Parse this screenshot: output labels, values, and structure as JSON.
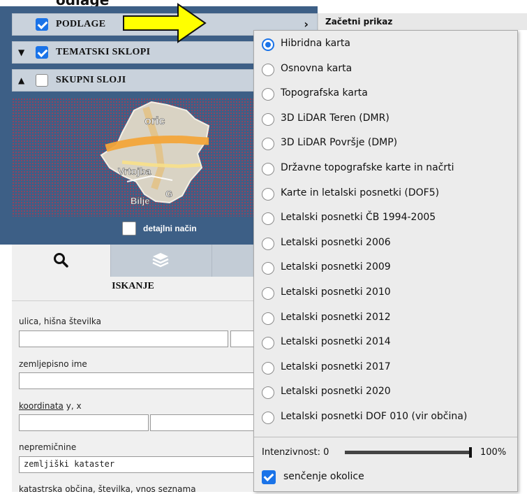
{
  "top_strip": {
    "text": "odlage"
  },
  "layers": [
    {
      "label": "PODLAGE",
      "checked": true,
      "caret": "",
      "chevron": "›"
    },
    {
      "label": "TEMATSKI SKLOPI",
      "checked": true,
      "caret": "▼",
      "chevron": ""
    },
    {
      "label": "SKUPNI SLOJI",
      "checked": false,
      "caret": "▲",
      "chevron": ""
    }
  ],
  "map": {
    "labels": [
      "oric",
      "Vrtojba",
      "Bilje",
      "G"
    ],
    "detail_label": "detajlni način",
    "detail_checked": false
  },
  "tabs": {
    "search_icon": "search-icon",
    "layers_icon": "layers-icon"
  },
  "search": {
    "title": "ISKANJE",
    "street_label": "ulica, hišna številka",
    "street_value": "",
    "house_value": "",
    "geo_label": "zemljepisno ime",
    "geo_value": "",
    "coord_label": "koordinata",
    "coord_suffix": "y, x",
    "coord_y_value": "",
    "coord_x_value": "",
    "realestate_label": "nepremičnine",
    "realestate_value": "zemljiški kataster",
    "cadastral_label": "katastrska občina, številka, vnos seznama"
  },
  "popup": {
    "title": "Začetni prikaz",
    "options": [
      {
        "label": "Hibridna karta",
        "selected": true
      },
      {
        "label": "Osnovna karta",
        "selected": false
      },
      {
        "label": "Topografska karta",
        "selected": false
      },
      {
        "label": "3D LiDAR Teren (DMR)",
        "selected": false
      },
      {
        "label": "3D LiDAR Površje (DMP)",
        "selected": false
      },
      {
        "label": "Državne topografske karte in načrti",
        "selected": false
      },
      {
        "label": "Karte in letalski posnetki (DOF5)",
        "selected": false
      },
      {
        "label": "Letalski posnetki ČB 1994-2005",
        "selected": false
      },
      {
        "label": "Letalski posnetki 2006",
        "selected": false
      },
      {
        "label": "Letalski posnetki 2009",
        "selected": false
      },
      {
        "label": "Letalski posnetki 2010",
        "selected": false
      },
      {
        "label": "Letalski posnetki 2012",
        "selected": false
      },
      {
        "label": "Letalski posnetki 2014",
        "selected": false
      },
      {
        "label": "Letalski posnetki 2017",
        "selected": false
      },
      {
        "label": "Letalski posnetki 2020",
        "selected": false
      },
      {
        "label": "Letalski posnetki DOF 010 (vir občina)",
        "selected": false
      }
    ],
    "intensity_label": "Intenzivnost: 0",
    "intensity_value_percent": 100,
    "intensity_max_label": "100%",
    "shading_label": "senčenje okolice",
    "shading_checked": true
  },
  "colors": {
    "panel_blue": "#3d5f86",
    "accent_blue": "#1a73e8",
    "arrow_yellow": "#ffff00"
  }
}
